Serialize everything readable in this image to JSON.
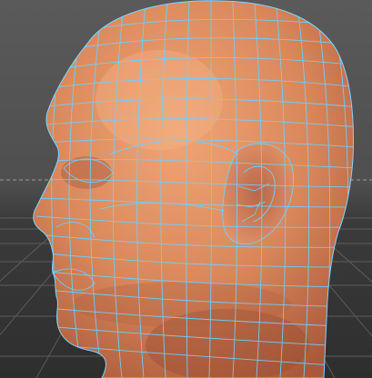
{
  "viewport": {
    "subject": "head-model",
    "view": "left-profile",
    "display_mode": "shaded-with-wireframe",
    "colors": {
      "background_top": "#5a5a5a",
      "background_bottom": "#2e2e2e",
      "grid_line": "#666666",
      "horizon_dashed": "#9a9a9a",
      "skin": "#d9875a",
      "skin_shadow": "#a9583a",
      "wireframe": "#6fd0ff"
    }
  }
}
